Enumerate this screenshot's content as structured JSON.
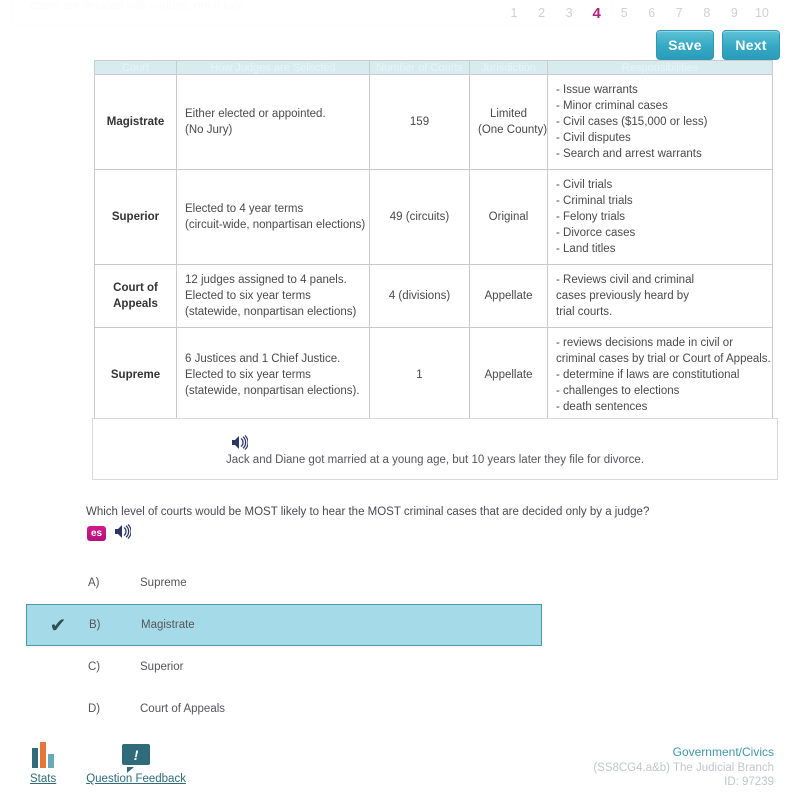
{
  "top_remnant": {
    "text": "cases are decided with a judge, not a jury"
  },
  "pagination": {
    "pages": [
      "1",
      "2",
      "3",
      "4",
      "5",
      "6",
      "7",
      "8",
      "9",
      "10"
    ],
    "active": "4",
    "active_color": "#b5207f"
  },
  "toolbar": {
    "save_label": "Save",
    "next_label": "Next",
    "button_color": "#35a9c4"
  },
  "table": {
    "headers": [
      "Court",
      "How Judges are Selected",
      "Number of Courts",
      "Jurisdiction",
      "Responsibilities"
    ],
    "rows": [
      {
        "court": "Magistrate",
        "selection_line1": "Either elected or appointed.",
        "selection_line2": "(No Jury)",
        "selection_line3": "",
        "number": "159",
        "jurisdiction_line1": "Limited",
        "jurisdiction_line2": "(One County)",
        "responsibilities": [
          "- Issue warrants",
          "- Minor criminal cases",
          "- Civil cases ($15,000 or less)",
          "- Civil disputes",
          "- Search and arrest warrants"
        ]
      },
      {
        "court": "Superior",
        "selection_line1": "Elected to 4 year terms",
        "selection_line2": "(circuit-wide, nonpartisan elections)",
        "selection_line3": "",
        "number": "49 (circuits)",
        "jurisdiction_line1": "Original",
        "jurisdiction_line2": "",
        "responsibilities": [
          "- Civil trials",
          "- Criminal trials",
          "- Felony trials",
          "- Divorce cases",
          "- Land titles"
        ]
      },
      {
        "court": "Court of Appeals",
        "selection_line1": "12 judges assigned to 4 panels.",
        "selection_line2": "Elected to six year terms",
        "selection_line3": "(statewide, nonpartisan elections)",
        "number": "4 (divisions)",
        "jurisdiction_line1": "Appellate",
        "jurisdiction_line2": "",
        "responsibilities": [
          "- Reviews civil and criminal",
          "cases previously heard by",
          "trial courts."
        ]
      },
      {
        "court": "Supreme",
        "selection_line1": "6 Justices and 1 Chief Justice.",
        "selection_line2": "Elected to six year terms",
        "selection_line3": "(statewide, nonpartisan elections).",
        "number": "1",
        "jurisdiction_line1": "Appellate",
        "jurisdiction_line2": "",
        "responsibilities": [
          "- reviews decisions made in civil or",
          "criminal cases by trial or Court of Appeals.",
          "- determine if laws are constitutional",
          "- challenges to elections",
          "- death sentences"
        ]
      }
    ]
  },
  "passage": {
    "audio_icon": "speaker-icon",
    "text": "Jack and Diane got married at a young age, but 10 years later they file for divorce."
  },
  "question": {
    "text": "Which level of courts would be MOST likely to hear the MOST criminal cases that are decided only by a judge?",
    "translate_badge": "es",
    "translate_badge_color": "#c4148a",
    "audio_icon": "speaker-icon"
  },
  "options": [
    {
      "letter": "A)",
      "label": "Supreme",
      "selected": false
    },
    {
      "letter": "B)",
      "label": "Magistrate",
      "selected": true
    },
    {
      "letter": "C)",
      "label": "Superior",
      "selected": false
    },
    {
      "letter": "D)",
      "label": "Court of Appeals",
      "selected": false
    }
  ],
  "selection": {
    "check_glyph": "✔",
    "highlight_color": "#a5dbe9",
    "border_color": "#4a98a8"
  },
  "footer": {
    "stats_label": "Stats",
    "feedback_label": "Question Feedback",
    "feedback_glyph": "!",
    "subject": "Government/Civics",
    "standard": "(SS8CG4.a&b) The Judicial Branch",
    "id": "ID: 97239",
    "subject_color": "#3f97ad"
  }
}
